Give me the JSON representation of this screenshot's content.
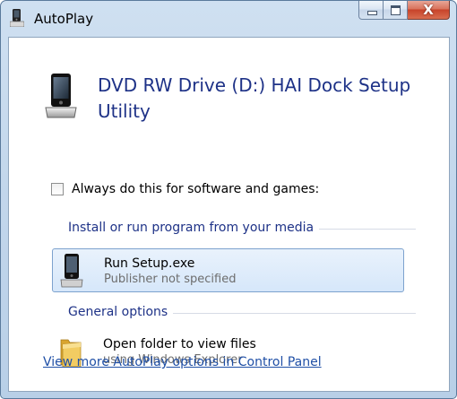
{
  "window": {
    "title": "AutoPlay",
    "close_glyph": "X"
  },
  "header": {
    "heading": "DVD RW Drive (D:) HAI Dock Setup Utility"
  },
  "always_checkbox": {
    "label": "Always do this for software and games:",
    "checked": false
  },
  "sections": {
    "install": {
      "header": "Install or run program from your media"
    },
    "general": {
      "header": "General options"
    }
  },
  "options": {
    "run_setup": {
      "title": "Run Setup.exe",
      "subtitle": "Publisher not specified"
    },
    "open_folder": {
      "title": "Open folder to view files",
      "subtitle": "using Windows Explorer"
    }
  },
  "footer": {
    "link": "View more AutoPlay options in Control Panel"
  },
  "colors": {
    "heading_blue": "#1e3287",
    "link_blue": "#1f4fa6",
    "highlight_border": "#7da2ce",
    "close_red": "#c7432a"
  }
}
